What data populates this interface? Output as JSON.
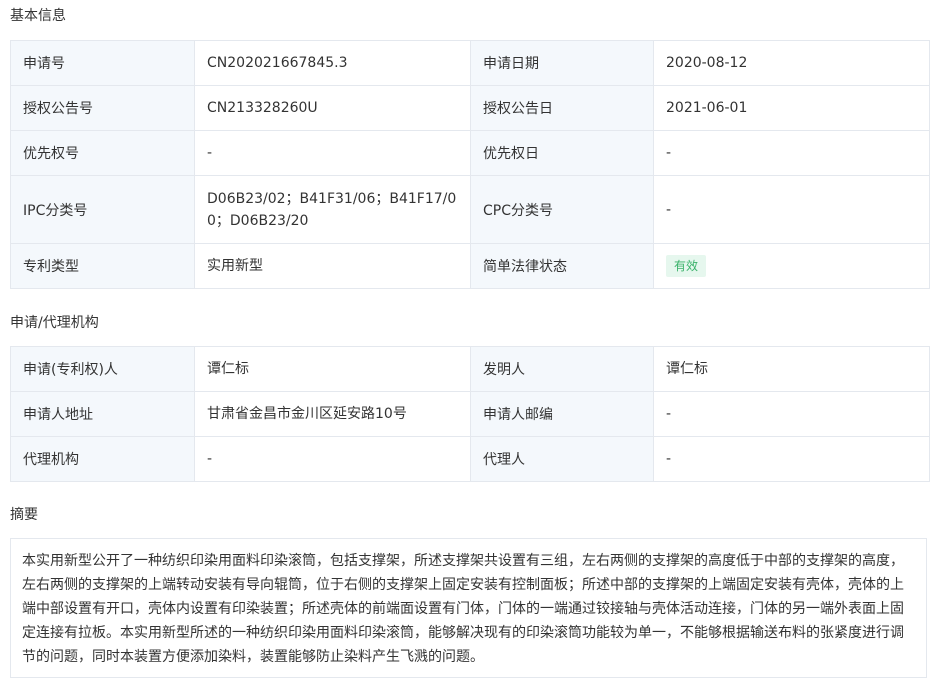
{
  "basic": {
    "title": "基本信息",
    "rows": [
      [
        "申请号",
        "CN202021667845.3",
        "申请日期",
        "2020-08-12"
      ],
      [
        "授权公告号",
        "CN213328260U",
        "授权公告日",
        "2021-06-01"
      ],
      [
        "优先权号",
        "-",
        "优先权日",
        "-"
      ],
      [
        "IPC分类号",
        "D06B23/02；B41F31/06；B41F17/00；D06B23/20",
        "CPC分类号",
        "-"
      ],
      [
        "专利类型",
        "实用新型",
        "简单法律状态",
        "有效"
      ]
    ]
  },
  "agency": {
    "title": "申请/代理机构",
    "rows": [
      [
        "申请(专利权)人",
        "谭仁标",
        "发明人",
        "谭仁标"
      ],
      [
        "申请人地址",
        "甘肃省金昌市金川区延安路10号",
        "申请人邮编",
        "-"
      ],
      [
        "代理机构",
        "-",
        "代理人",
        "-"
      ]
    ]
  },
  "abstract": {
    "title": "摘要",
    "text": "本实用新型公开了一种纺织印染用面料印染滚筒，包括支撑架，所述支撑架共设置有三组，左右两侧的支撑架的高度低于中部的支撑架的高度，左右两侧的支撑架的上端转动安装有导向辊筒，位于右侧的支撑架上固定安装有控制面板；所述中部的支撑架的上端固定安装有壳体，壳体的上端中部设置有开口，壳体内设置有印染装置；所述壳体的前端面设置有门体，门体的一端通过铰接轴与壳体活动连接，门体的另一端外表面上固定连接有拉板。本实用新型所述的一种纺织印染用面料印染滚筒，能够解决现有的印染滚筒功能较为单一，不能够根据输送布料的张紧度进行调节的问题，同时本装置方便添加染料，装置能够防止染料产生飞溅的问题。"
  },
  "colors": {
    "label_bg": "#f4f8fc",
    "border": "#e4e8ee",
    "status_green": "#3ab26a",
    "status_bg": "#e6f7ee"
  }
}
